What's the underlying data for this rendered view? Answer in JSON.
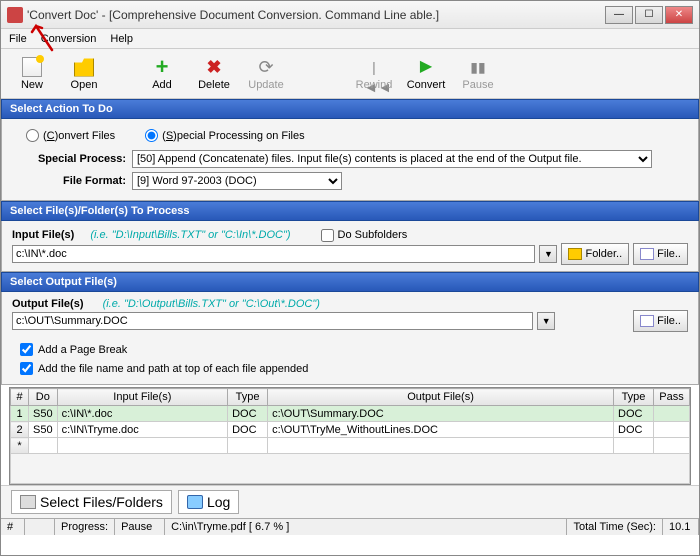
{
  "window": {
    "title": "'Convert Doc' - [Comprehensive Document Conversion. Command Line able.]"
  },
  "menu": {
    "file": "File",
    "conversion": "Conversion",
    "help": "Help"
  },
  "toolbar": {
    "new": "New",
    "open": "Open",
    "add": "Add",
    "delete": "Delete",
    "update": "Update",
    "rewind": "Rewind",
    "convert": "Convert",
    "pause": "Pause"
  },
  "sections": {
    "action": "Select Action To Do",
    "input": "Select File(s)/Folder(s) To Process",
    "output": "Select Output File(s)"
  },
  "action": {
    "convert_label_pre": "(",
    "convert_u": "C",
    "convert_label_post": ")onvert Files",
    "special_label_pre": "(",
    "special_u": "S",
    "special_label_post": ")pecial Processing on Files",
    "special_process_lbl": "Special Process:",
    "special_process_val": "[50] Append (Concatenate) files. Input file(s) contents is placed at the end of the Output file.",
    "file_format_lbl": "File Format:",
    "file_format_val": "[9] Word 97-2003 (DOC)"
  },
  "input": {
    "label": "Input File(s)",
    "hint": "(i.e. \"D:\\Input\\Bills.TXT\"  or  \"C:\\In\\*.DOC\")",
    "do_subfolders": "Do Subfolders",
    "value": "c:\\IN\\*.doc",
    "folder_btn": "Folder..",
    "file_btn": "File.."
  },
  "output": {
    "label": "Output File(s)",
    "hint": "(i.e. \"D:\\Output\\Bills.TXT\"  or  \"C:\\Out\\*.DOC\")",
    "value": "c:\\OUT\\Summary.DOC",
    "file_btn": "File.."
  },
  "options": {
    "page_break": "Add a Page Break",
    "filename_path": "Add the file name and path at top of each file appended"
  },
  "grid": {
    "headers": {
      "num": "#",
      "do": "Do",
      "input": "Input File(s)",
      "type": "Type",
      "output": "Output File(s)",
      "type2": "Type",
      "pass": "Pass"
    },
    "rows": [
      {
        "n": "1",
        "do": "S50",
        "input": "c:\\IN\\*.doc",
        "type": "DOC",
        "output": "c:\\OUT\\Summary.DOC",
        "type2": "DOC",
        "pass": ""
      },
      {
        "n": "2",
        "do": "S50",
        "input": "c:\\IN\\Tryme.doc",
        "type": "DOC",
        "output": "c:\\OUT\\TryMe_WithoutLines.DOC",
        "type2": "DOC",
        "pass": ""
      }
    ],
    "star": "*"
  },
  "tabs": {
    "select": "Select Files/Folders",
    "log": "Log"
  },
  "status": {
    "num": "#",
    "progress": "Progress:",
    "pause": "Pause",
    "path": "C:\\in\\Tryme.pdf  [ 6.7 % ]",
    "total": "Total Time (Sec):",
    "total_val": "10.1"
  }
}
